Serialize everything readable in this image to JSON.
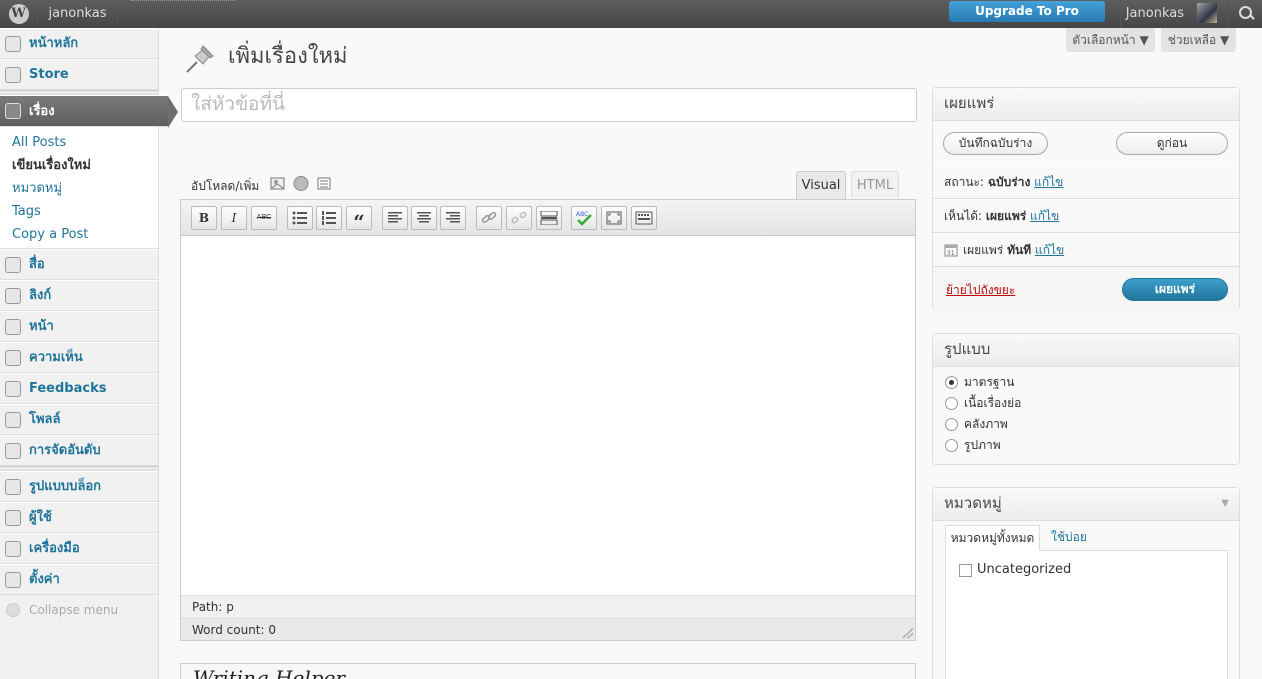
{
  "adminbar": {
    "site_name": "janonkas",
    "upgrade_label": "Upgrade To Pro",
    "user_name": "Janonkas"
  },
  "sidebar": {
    "items": [
      {
        "label": "หน้าหลัก",
        "icon": "home-icon"
      },
      {
        "label": "Store",
        "icon": "cart-icon"
      },
      {
        "label": "เรื่อง",
        "icon": "pushpin-icon"
      },
      {
        "label": "สื่อ",
        "icon": "media-icon"
      },
      {
        "label": "ลิงก์",
        "icon": "link-icon"
      },
      {
        "label": "หน้า",
        "icon": "pages-icon"
      },
      {
        "label": "ความเห็น",
        "icon": "comments-icon"
      },
      {
        "label": "Feedbacks",
        "icon": "feedback-icon"
      },
      {
        "label": "โพลล์",
        "icon": "polls-icon"
      },
      {
        "label": "การจัดอันดับ",
        "icon": "ratings-icon"
      },
      {
        "label": "รูปแบบบล็อก",
        "icon": "appearance-icon"
      },
      {
        "label": "ผู้ใช้",
        "icon": "users-icon"
      },
      {
        "label": "เครื่องมือ",
        "icon": "tools-icon"
      },
      {
        "label": "ตั้งค่า",
        "icon": "settings-icon"
      }
    ],
    "submenu": [
      "All Posts",
      "เขียนเรื่องใหม่",
      "หมวดหมู่",
      "Tags",
      "Copy a Post"
    ],
    "collapse_label": "Collapse menu"
  },
  "header": {
    "screen_options": "ตัวเลือกหน้า",
    "help": "ช่วยเหลือ",
    "page_title": "เพิ่มเรื่องใหม่"
  },
  "editor": {
    "title_placeholder": "ใส่หัวข้อที่นี่",
    "media_label": "อัปโหลด/เพิ่ม",
    "tab_visual": "Visual",
    "tab_html": "HTML",
    "toolbar": {
      "bold": "B",
      "italic": "I",
      "strikethrough": "ABC",
      "blockquote": "“"
    },
    "path_label": "Path:",
    "path_value": "p",
    "word_count_label": "Word count:",
    "word_count_value": "0"
  },
  "writing_helper_title": "Writing Helper",
  "publish": {
    "title": "เผยแพร่",
    "save_draft": "บันทึกฉบับร่าง",
    "preview": "ดูก่อน",
    "status_label": "สถานะ:",
    "status_value": "ฉบับร่าง",
    "visibility_label": "เห็นได้:",
    "visibility_value": "เผยแพร่",
    "schedule_label": "เผยแพร่",
    "schedule_value": "ทันที",
    "edit_link": "แก้ไข",
    "trash": "ย้ายไปถังขยะ",
    "publish_btn": "เผยแพร่"
  },
  "format": {
    "title": "รูปแบบ",
    "options": [
      "มาตรฐาน",
      "เนื้อเรื่องย่อ",
      "คลังภาพ",
      "รูปภาพ"
    ],
    "selected": "มาตรฐาน"
  },
  "categories": {
    "title": "หมวดหมู่",
    "tab_all": "หมวดหมู่ทั้งหมด",
    "tab_popular": "ใช้บ่อย",
    "items": [
      "Uncategorized"
    ]
  }
}
